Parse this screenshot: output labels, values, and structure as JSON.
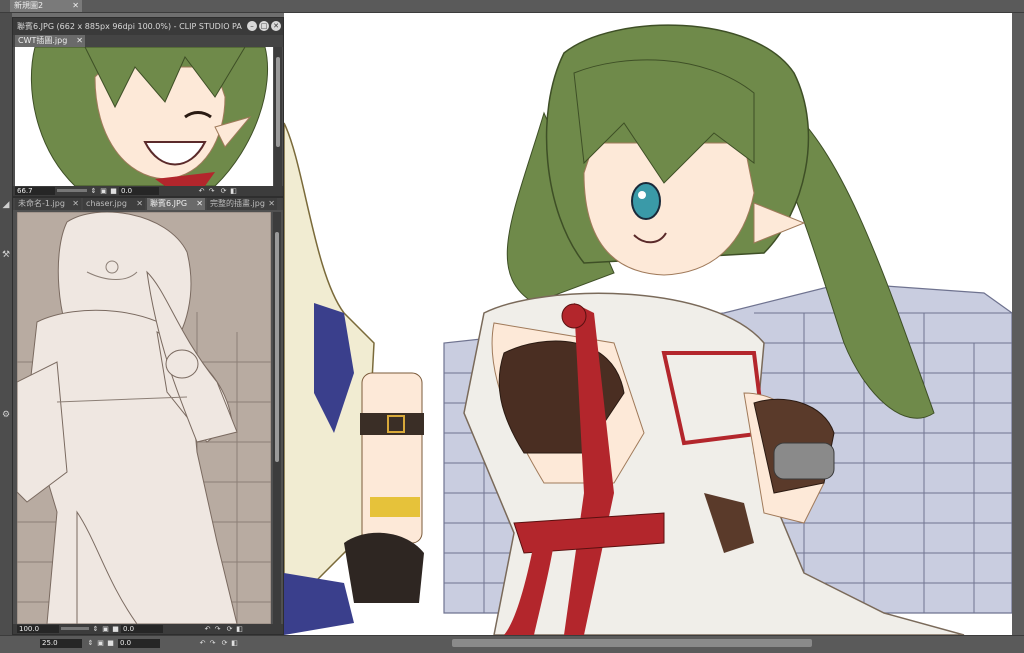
{
  "main_document": {
    "tab_label": "新規圖2",
    "close_glyph": "✕"
  },
  "subwindow_top": {
    "title": "聯賓6.JPG (662 x 885px 96dpi 100.0%) - CLIP STUDIO PA",
    "tab_label": "CWT插圖.jpg",
    "zoom": "66.7",
    "rotation": "0.0",
    "min_glyph": "–",
    "max_glyph": "□",
    "close_glyph": "✕"
  },
  "subwindow_bottom": {
    "tabs": [
      {
        "label": "未命名-1.jpg",
        "active": false
      },
      {
        "label": "chaser.jpg",
        "active": false
      },
      {
        "label": "聯賓6.JPG",
        "active": true
      },
      {
        "label": "完整的插畫.jpg",
        "active": false
      }
    ],
    "zoom": "100.0",
    "rotation": "0.0"
  },
  "bottom_ruler": {
    "zoom": "25.0",
    "rotation": "0.0"
  },
  "colors": {
    "hair": "#6f8a4a",
    "hair_dark": "#4f6a36",
    "skin": "#fde9d8",
    "outfit_red": "#b3262c",
    "bra": "#4a2e22",
    "wall": "#c9cde0",
    "wall_line": "#6f7390",
    "sepia_bg": "#b8aba1",
    "sepia_fg": "#efe7e1"
  }
}
